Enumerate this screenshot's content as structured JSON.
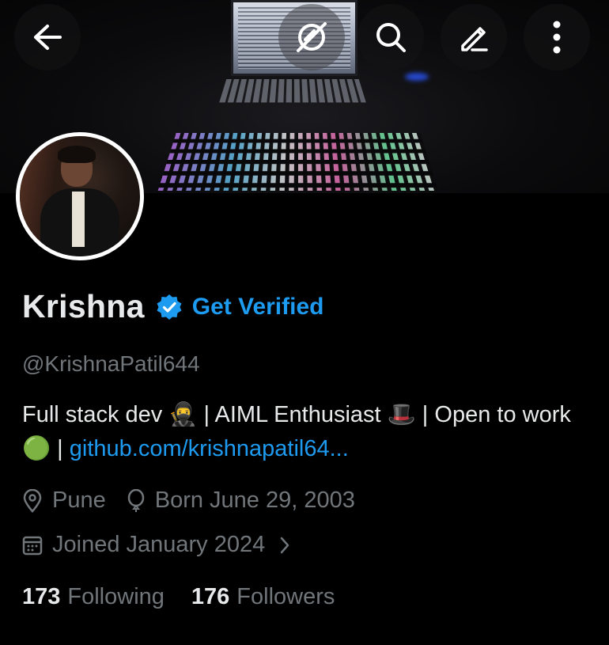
{
  "profile": {
    "name": "Krishna",
    "get_verified": "Get Verified",
    "handle": "@KrishnaPatil644",
    "bio_text_1": "Full stack dev 🥷 | AIML Enthusiast 🎩 | Open to work 🟢 | ",
    "bio_link": "github.com/krishnapatil64...",
    "location": "Pune",
    "birthday": "Born June 29, 2003",
    "joined": "Joined January 2024",
    "following_count": "173",
    "following_label": "Following",
    "followers_count": "176",
    "followers_label": "Followers"
  },
  "icons": {
    "back": "back-arrow-icon",
    "grok": "grok-icon",
    "search": "search-icon",
    "edit": "edit-pencil-icon",
    "more": "more-vertical-icon",
    "verified": "verified-badge-icon",
    "location": "location-pin-icon",
    "birthday": "balloon-icon",
    "calendar": "calendar-icon",
    "chevron": "chevron-right-icon"
  },
  "colors": {
    "background": "#000000",
    "primary_text": "#e7e9ea",
    "secondary_text": "#71767b",
    "accent": "#1d9bf0"
  }
}
